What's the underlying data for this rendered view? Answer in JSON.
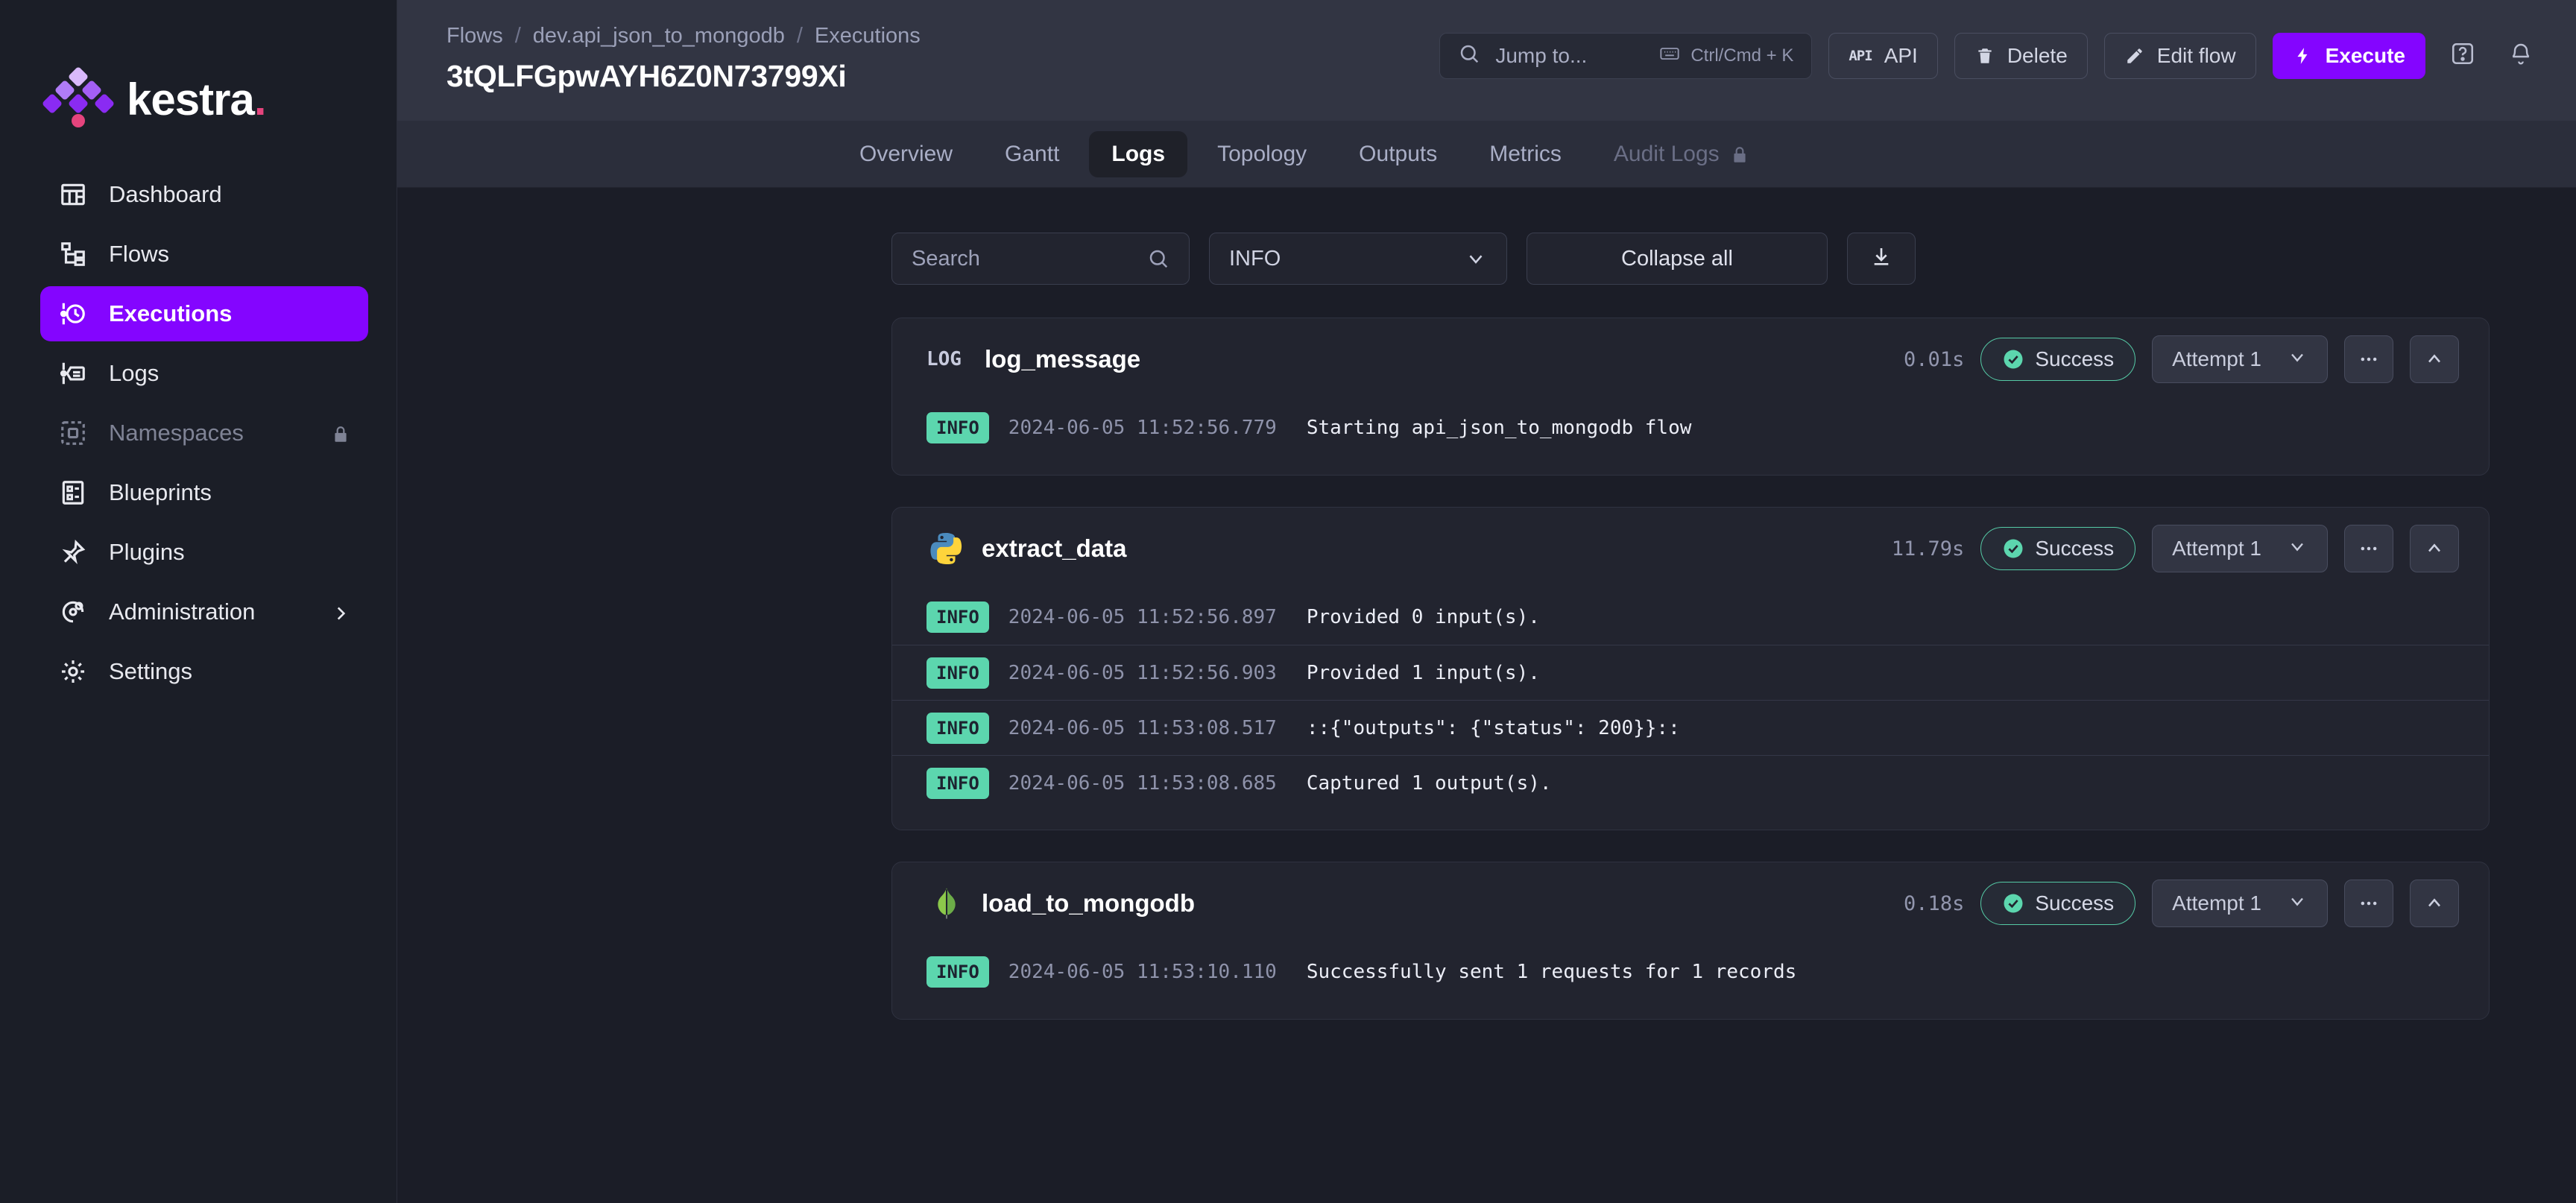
{
  "brand": {
    "name": "kestra",
    "dot": ".",
    "accent": "#8405ff",
    "pink": "#e5447d"
  },
  "sidebar": {
    "items": [
      {
        "label": "Dashboard",
        "icon": "dashboard-icon",
        "state": "normal"
      },
      {
        "label": "Flows",
        "icon": "flows-icon",
        "state": "normal"
      },
      {
        "label": "Executions",
        "icon": "executions-icon",
        "state": "active"
      },
      {
        "label": "Logs",
        "icon": "logs-icon",
        "state": "normal"
      },
      {
        "label": "Namespaces",
        "icon": "namespaces-icon",
        "state": "locked"
      },
      {
        "label": "Blueprints",
        "icon": "blueprints-icon",
        "state": "normal"
      },
      {
        "label": "Plugins",
        "icon": "plugins-icon",
        "state": "normal"
      },
      {
        "label": "Administration",
        "icon": "administration-icon",
        "state": "expandable"
      },
      {
        "label": "Settings",
        "icon": "settings-icon",
        "state": "normal"
      }
    ]
  },
  "header": {
    "breadcrumb": [
      "Flows",
      "dev.api_json_to_mongodb",
      "Executions"
    ],
    "separator": "/",
    "execution_id": "3tQLFGpwAYH6Z0N73799Xi",
    "search": {
      "placeholder": "Jump to...",
      "shortcut": "Ctrl/Cmd + K"
    },
    "buttons": {
      "api": "API",
      "delete": "Delete",
      "edit_flow": "Edit flow",
      "execute": "Execute"
    }
  },
  "tabs": [
    {
      "label": "Overview",
      "state": "normal"
    },
    {
      "label": "Gantt",
      "state": "normal"
    },
    {
      "label": "Logs",
      "state": "active"
    },
    {
      "label": "Topology",
      "state": "normal"
    },
    {
      "label": "Outputs",
      "state": "normal"
    },
    {
      "label": "Metrics",
      "state": "normal"
    },
    {
      "label": "Audit Logs",
      "state": "locked"
    }
  ],
  "filters": {
    "search_placeholder": "Search",
    "level": "INFO",
    "collapse_all": "Collapse all",
    "download_icon": "download-icon"
  },
  "tasks": [
    {
      "badge": "LOG",
      "icon": "log-text-badge",
      "name": "log_message",
      "duration": "0.01s",
      "status": "Success",
      "attempt": "Attempt 1",
      "lines": [
        {
          "level": "INFO",
          "timestamp": "2024-06-05 11:52:56.779",
          "message": "Starting api_json_to_mongodb flow"
        }
      ]
    },
    {
      "badge": "",
      "icon": "python-icon",
      "name": "extract_data",
      "duration": "11.79s",
      "status": "Success",
      "attempt": "Attempt 1",
      "lines": [
        {
          "level": "INFO",
          "timestamp": "2024-06-05 11:52:56.897",
          "message": "Provided 0 input(s)."
        },
        {
          "level": "INFO",
          "timestamp": "2024-06-05 11:52:56.903",
          "message": "Provided 1 input(s)."
        },
        {
          "level": "INFO",
          "timestamp": "2024-06-05 11:53:08.517",
          "message": "::{\"outputs\": {\"status\": 200}}::"
        },
        {
          "level": "INFO",
          "timestamp": "2024-06-05 11:53:08.685",
          "message": "Captured 1 output(s)."
        }
      ]
    },
    {
      "badge": "",
      "icon": "mongodb-icon",
      "name": "load_to_mongodb",
      "duration": "0.18s",
      "status": "Success",
      "attempt": "Attempt 1",
      "lines": [
        {
          "level": "INFO",
          "timestamp": "2024-06-05 11:53:10.110",
          "message": "Successfully sent 1 requests for 1 records"
        }
      ]
    }
  ]
}
